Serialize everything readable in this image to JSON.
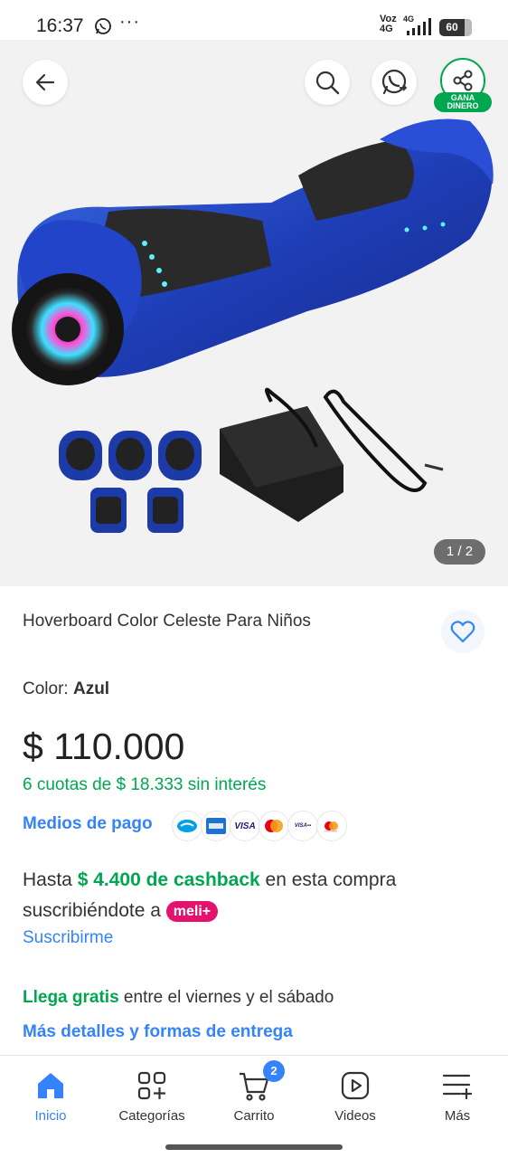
{
  "status_bar": {
    "time": "16:37",
    "dots": "···",
    "network_top": "Voz",
    "network_bottom": "4G",
    "network_small": "4G",
    "battery": "60"
  },
  "gallery": {
    "page_indicator": "1 / 2",
    "share_badge_line1": "GANA",
    "share_badge_line2": "DINERO"
  },
  "product": {
    "title": "Hoverboard Color Celeste Para Niños",
    "color_label": "Color: ",
    "color_value": "Azul",
    "price": "$ 110.000",
    "installments": "6 cuotas de $ 18.333 sin interés",
    "payment_methods_label": "Medios de pago",
    "payment_icons": [
      "mercadopago-icon",
      "amex-icon",
      "visa-icon",
      "mastercard-icon",
      "visa-debit-icon",
      "maestro-icon"
    ],
    "cashback_prefix": "Hasta ",
    "cashback_amount": "$ 4.400 de cashback",
    "cashback_suffix": " en esta compra suscribiéndote a ",
    "meli_plus": "meli+",
    "subscribe_link": "Suscribirme",
    "shipping_bold": "Llega gratis",
    "shipping_rest": " entre el viernes y el sábado",
    "more_details_link": "Más detalles y formas de entrega"
  },
  "bottom_nav": {
    "items": [
      {
        "label": "Inicio",
        "icon": "home-icon",
        "active": true
      },
      {
        "label": "Categorías",
        "icon": "categories-icon",
        "active": false
      },
      {
        "label": "Carrito",
        "icon": "cart-icon",
        "active": false
      },
      {
        "label": "Videos",
        "icon": "video-icon",
        "active": false
      },
      {
        "label": "Más",
        "icon": "menu-icon",
        "active": false
      }
    ],
    "cart_count": "2"
  },
  "colors": {
    "accent_blue": "#3483fa",
    "green": "#00a650",
    "meli_pink": "#e3126c"
  }
}
